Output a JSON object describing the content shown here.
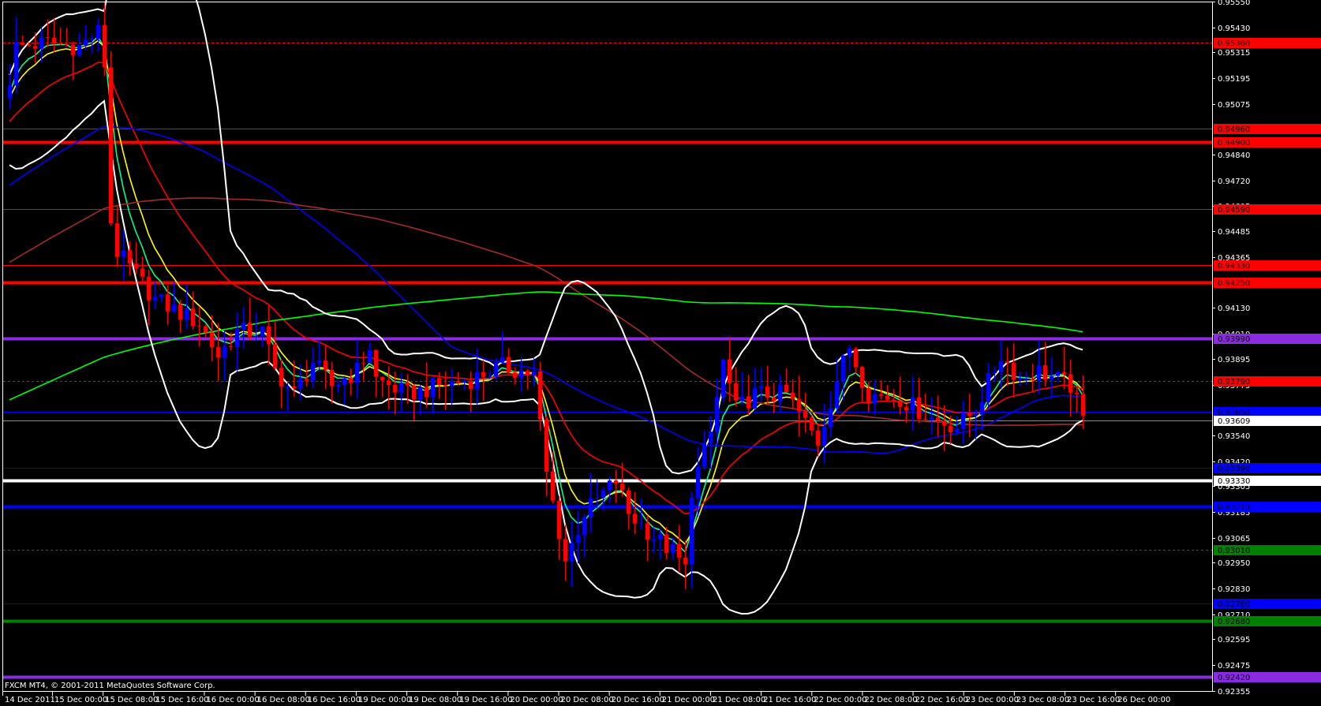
{
  "window": {
    "footer": "FXCM MT4, © 2001-2011 MetaQuotes Software Corp."
  },
  "chart_data": {
    "type": "candlestick",
    "title": "",
    "timeframe_hours": 1,
    "ylim": [
      0.92355,
      0.9555
    ],
    "y_ticks": [
      "0.95550",
      "0.95430",
      "0.95315",
      "0.95195",
      "0.95075",
      "0.94840",
      "0.94720",
      "0.94605",
      "0.94485",
      "0.94365",
      "0.94130",
      "0.94010",
      "0.93895",
      "0.93775",
      "0.93540",
      "0.93420",
      "0.93305",
      "0.93185",
      "0.93065",
      "0.92950",
      "0.92830",
      "0.92710",
      "0.92595",
      "0.92475",
      "0.92355"
    ],
    "x_labels": [
      "14 Dec 2011",
      "15 Dec 00:00",
      "15 Dec 08:00",
      "15 Dec 16:00",
      "16 Dec 00:00",
      "16 Dec 08:00",
      "16 Dec 16:00",
      "19 Dec 00:00",
      "19 Dec 08:00",
      "19 Dec 16:00",
      "20 Dec 00:00",
      "20 Dec 08:00",
      "20 Dec 16:00",
      "21 Dec 00:00",
      "21 Dec 08:00",
      "21 Dec 16:00",
      "22 Dec 00:00",
      "22 Dec 08:00",
      "22 Dec 16:00",
      "23 Dec 00:00",
      "23 Dec 08:00",
      "23 Dec 16:00",
      "26 Dec 00:00"
    ],
    "candle_count": 171,
    "close_keyframes": [
      [
        0,
        0.9519
      ],
      [
        1,
        0.9534
      ],
      [
        6,
        0.9536
      ],
      [
        11,
        0.9534
      ],
      [
        14,
        0.9541
      ],
      [
        15,
        0.9526
      ],
      [
        16,
        0.9453
      ],
      [
        17,
        0.9439
      ],
      [
        20,
        0.9428
      ],
      [
        23,
        0.9417
      ],
      [
        30,
        0.9406
      ],
      [
        33,
        0.9391
      ],
      [
        36,
        0.9402
      ],
      [
        40,
        0.9402
      ],
      [
        42,
        0.9384
      ],
      [
        45,
        0.9373
      ],
      [
        48,
        0.9388
      ],
      [
        51,
        0.9377
      ],
      [
        55,
        0.9384
      ],
      [
        57,
        0.9395
      ],
      [
        58,
        0.938
      ],
      [
        63,
        0.9373
      ],
      [
        68,
        0.9377
      ],
      [
        73,
        0.938
      ],
      [
        78,
        0.9386
      ],
      [
        83,
        0.9382
      ],
      [
        85,
        0.9336
      ],
      [
        88,
        0.9296
      ],
      [
        91,
        0.9318
      ],
      [
        96,
        0.9333
      ],
      [
        98,
        0.9318
      ],
      [
        102,
        0.9307
      ],
      [
        105,
        0.93
      ],
      [
        107,
        0.9292
      ],
      [
        108,
        0.9329
      ],
      [
        111,
        0.9355
      ],
      [
        113,
        0.9388
      ],
      [
        115,
        0.9366
      ],
      [
        118,
        0.9373
      ],
      [
        123,
        0.9373
      ],
      [
        128,
        0.9351
      ],
      [
        131,
        0.938
      ],
      [
        133,
        0.9395
      ],
      [
        136,
        0.9373
      ],
      [
        141,
        0.9371
      ],
      [
        146,
        0.9362
      ],
      [
        150,
        0.9358
      ],
      [
        153,
        0.9366
      ],
      [
        157,
        0.9391
      ],
      [
        160,
        0.938
      ],
      [
        163,
        0.9384
      ],
      [
        168,
        0.9377
      ],
      [
        170,
        0.9361
      ]
    ],
    "indicators": [
      {
        "name": "EMA 5",
        "type": "ema",
        "period": 5,
        "color": "#00ff88"
      },
      {
        "name": "EMA 8",
        "type": "ema",
        "period": 8,
        "color": "#ffff00"
      },
      {
        "name": "EMA 21",
        "type": "ema",
        "period": 21,
        "color": "#ff0000"
      },
      {
        "name": "SMA 55",
        "type": "sma",
        "period": 55,
        "color": "#0000ff"
      },
      {
        "name": "SMA 100",
        "type": "sma",
        "period": 100,
        "color": "#a52a2a"
      },
      {
        "name": "SMA 200",
        "type": "sma",
        "period": 200,
        "color": "#00ff00"
      },
      {
        "name": "Bollinger 20,2",
        "type": "bb",
        "period": 20,
        "dev": 2,
        "color": "#ffffff"
      }
    ],
    "levels": [
      {
        "price": 0.9536,
        "label": "0.95360",
        "color": "#ff0000",
        "style": "dash",
        "weight": "thin",
        "text": "#000"
      },
      {
        "price": 0.9496,
        "label": "0.94960",
        "color": "#ff0000",
        "style": "solid",
        "weight": "thin",
        "text": "#000"
      },
      {
        "price": 0.949,
        "label": "0.94900",
        "color": "#ff0000",
        "style": "solid",
        "weight": "thick",
        "text": "#000"
      },
      {
        "price": 0.9459,
        "label": "0.94590",
        "color": "#ff0000",
        "style": "solid",
        "weight": "thin",
        "text": "#000"
      },
      {
        "price": 0.9433,
        "label": "0.94330",
        "color": "#ff0000",
        "style": "solid",
        "weight": "thin",
        "text": "#000"
      },
      {
        "price": 0.9425,
        "label": "0.94250",
        "color": "#ff0000",
        "style": "solid",
        "weight": "thick",
        "text": "#000"
      },
      {
        "price": 0.9399,
        "label": "0.93990",
        "color": "#8a2be2",
        "style": "solid",
        "weight": "thick",
        "text": "#000"
      },
      {
        "price": 0.9379,
        "label": "0.93790",
        "color": "#ff0000",
        "style": "dash",
        "weight": "thin",
        "text": "#000"
      },
      {
        "price": 0.9365,
        "label": "0.93650",
        "color": "#0000ff",
        "style": "solid",
        "weight": "thin",
        "text": "#000"
      },
      {
        "price": 0.93609,
        "label": "0.93609",
        "color": "#8090a0",
        "style": "solid",
        "weight": "thin",
        "text": "#000",
        "bg": "#ffffff"
      },
      {
        "price": 0.9339,
        "label": "0.93390",
        "color": "#0000ff",
        "style": "solid",
        "weight": "thin",
        "text": "#000"
      },
      {
        "price": 0.9333,
        "label": "0.93330",
        "color": "#ffffff",
        "style": "solid",
        "weight": "thick",
        "text": "#000"
      },
      {
        "price": 0.9321,
        "label": "0.93210",
        "color": "#0000ff",
        "style": "solid",
        "weight": "thick",
        "text": "#000"
      },
      {
        "price": 0.9301,
        "label": "0.93010",
        "color": "#008000",
        "style": "dash",
        "weight": "thin",
        "text": "#000"
      },
      {
        "price": 0.9276,
        "label": "0.92760",
        "color": "#0000ff",
        "style": "solid",
        "weight": "thin",
        "text": "#000"
      },
      {
        "price": 0.9268,
        "label": "0.92680",
        "color": "#008000",
        "style": "solid",
        "weight": "thick",
        "text": "#000"
      },
      {
        "price": 0.9242,
        "label": "0.92420",
        "color": "#8a2be2",
        "style": "solid",
        "weight": "thick",
        "text": "#000"
      }
    ],
    "colors": {
      "bull": "#0000ff",
      "bear": "#ff0000",
      "background": "#000000",
      "grid": "none"
    }
  }
}
